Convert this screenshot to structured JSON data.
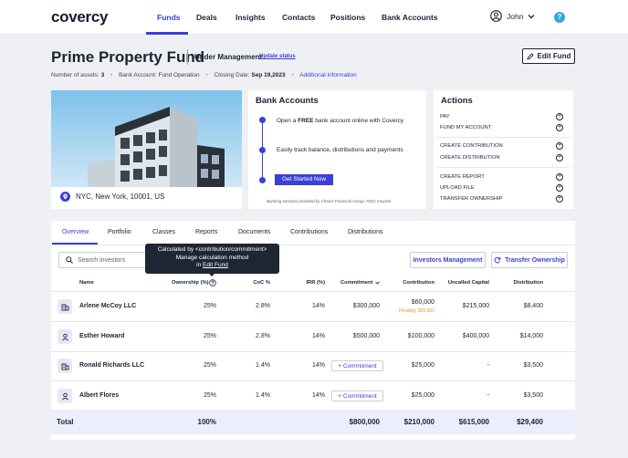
{
  "nav": {
    "logo": "covercy",
    "items": [
      "Funds",
      "Deals",
      "Insights",
      "Contacts",
      "Positions",
      "Bank Accounts"
    ],
    "user_name": "John",
    "help": "?"
  },
  "fund": {
    "title": "Prime Property Fund",
    "status": "Under Management",
    "update_status": "Update status",
    "edit_label": "Edit Fund",
    "assets_label": "Number of assets:",
    "assets_value": "3",
    "bank_label": "Bank Account:",
    "bank_value": "Fund Operation",
    "closing_label": "Closing Date:",
    "closing_value": "Sep 19,2023",
    "additional_info": "Additional information"
  },
  "property": {
    "location": "NYC, New York, 10001, US"
  },
  "bank": {
    "title": "Bank Accounts",
    "step1_pre": "Open a ",
    "step1_bold": "FREE",
    "step1_post": " bank account online with Covercy",
    "step2": "Easily track balance, distributions and payments",
    "cta": "Get Started Now",
    "note": "Banking services provided by Choice Financial Group; FDIC Insured"
  },
  "actions": {
    "title": "Actions",
    "items": [
      "PAY",
      "FUND MY ACCOUNT",
      "CREATE CONTRIBUTION",
      "CREATE DISTRIBUTION",
      "CREATE REPORT",
      "UPLOAD FILE",
      "TRANSFER OWNERSHIP"
    ]
  },
  "tabs": [
    "Overview",
    "Portfolio",
    "Classes",
    "Reports",
    "Documents",
    "Contributions",
    "Distributions"
  ],
  "search": {
    "placeholder": "Search investors"
  },
  "tooltip": {
    "line1": "Calculated by <contribution/commitment>",
    "line2": "Manage calculation method",
    "line3_pre": "in ",
    "line3_link": "Edit Fund"
  },
  "buttons": {
    "investors_management": "Investors Management",
    "transfer_ownership": "Transfer Ownership"
  },
  "table": {
    "columns": [
      "Name",
      "Ownership (%)",
      "CoC %",
      "IRR (%)",
      "Commitment",
      "Contribution",
      "Uncalled Capital",
      "Distribution"
    ],
    "rows": [
      {
        "type": "company",
        "name": "Arlene McCoy LLC",
        "ownership": "25%",
        "coc": "2.8%",
        "irr": "14%",
        "commitment": "$300,000",
        "contribution": "$60,000",
        "pending": "Pending: $20,000",
        "uncalled": "$215,000",
        "distribution": "$8,400"
      },
      {
        "type": "person",
        "name": "Esther Howard",
        "ownership": "25%",
        "coc": "2.8%",
        "irr": "14%",
        "commitment": "$500,000",
        "contribution": "$100,000",
        "pending": "",
        "uncalled": "$400,000",
        "distribution": "$14,000"
      },
      {
        "type": "company",
        "name": "Ronald Richards LLC",
        "ownership": "25%",
        "coc": "1.4%",
        "irr": "14%",
        "commitment": "+ Commitment",
        "contribution": "$25,000",
        "pending": "",
        "uncalled": "-",
        "distribution": "$3,500"
      },
      {
        "type": "person",
        "name": "Albert Flores",
        "ownership": "25%",
        "coc": "1.4%",
        "irr": "14%",
        "commitment": "+ Commitment",
        "contribution": "$25,000",
        "pending": "",
        "uncalled": "-",
        "distribution": "$3,500"
      }
    ],
    "total": {
      "label": "Total",
      "ownership": "100%",
      "commitment": "$800,000",
      "contribution": "$210,000",
      "uncalled": "$615,000",
      "distribution": "$29,400"
    }
  },
  "colors": {
    "accent": "#3b3fd8",
    "pending": "#f0922b",
    "total_bg": "#eceefb",
    "page_bg": "#eef0f4"
  }
}
